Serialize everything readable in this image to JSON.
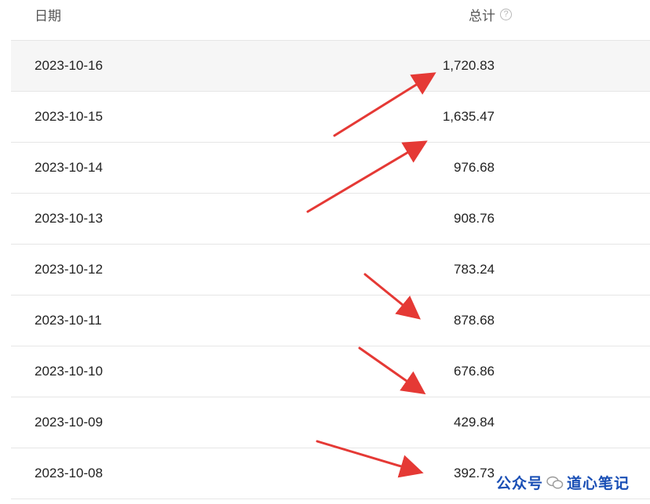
{
  "table": {
    "headers": {
      "date": "日期",
      "total": "总计",
      "help_icon": "question-circle-icon"
    },
    "rows": [
      {
        "date": "2023-10-16",
        "total": "1,720.83"
      },
      {
        "date": "2023-10-15",
        "total": "1,635.47"
      },
      {
        "date": "2023-10-14",
        "total": "976.68"
      },
      {
        "date": "2023-10-13",
        "total": "908.76"
      },
      {
        "date": "2023-10-12",
        "total": "783.24"
      },
      {
        "date": "2023-10-11",
        "total": "878.68"
      },
      {
        "date": "2023-10-10",
        "total": "676.86"
      },
      {
        "date": "2023-10-09",
        "total": "429.84"
      },
      {
        "date": "2023-10-08",
        "total": "392.73"
      }
    ]
  },
  "annotations": {
    "arrow_color": "#e53935",
    "arrow_count": 5
  },
  "watermark": {
    "prefix": "公众号",
    "name": "道心笔记",
    "icon": "wechat-icon"
  },
  "colors": {
    "accent": "#e0252b",
    "highlight_row": "#f6f6f6",
    "watermark_text": "#1a4fb5"
  }
}
